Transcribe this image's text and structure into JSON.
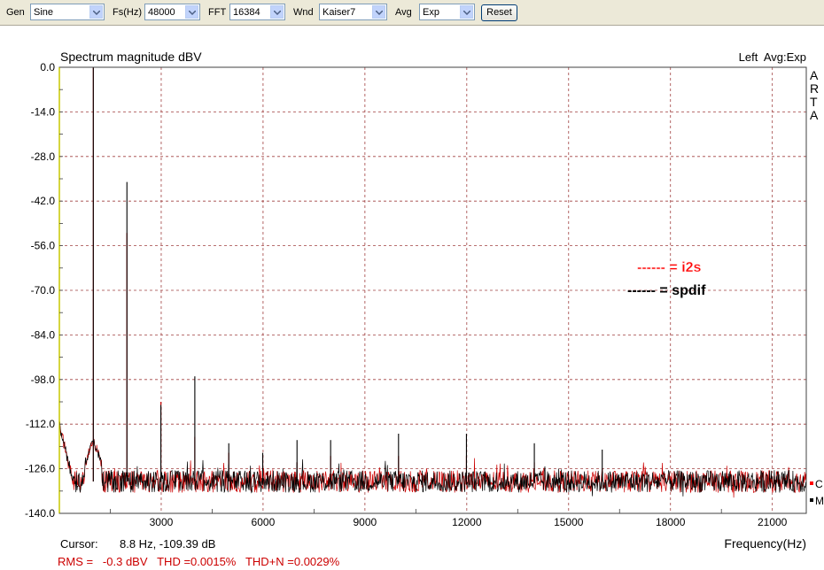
{
  "toolbar": {
    "gen_label": "Gen",
    "gen_value": "Sine",
    "fs_label": "Fs(Hz)",
    "fs_value": "48000",
    "fft_label": "FFT",
    "fft_value": "16384",
    "wnd_label": "Wnd",
    "wnd_value": "Kaiser7",
    "avg_label": "Avg",
    "avg_value": "Exp",
    "reset_label": "Reset"
  },
  "chart_data": {
    "type": "line",
    "title": "Spectrum magnitude dBV",
    "top_right_label": "Left  Avg:Exp",
    "brand_letters": [
      "A",
      "R",
      "T",
      "A"
    ],
    "xlabel": "Frequency(Hz)",
    "xlim": [
      0,
      22000
    ],
    "ylim": [
      -140,
      0
    ],
    "grid": true,
    "x_ticks": [
      3000,
      6000,
      9000,
      12000,
      15000,
      18000,
      21000
    ],
    "x_tick_labels": [
      "3000",
      "6000",
      "9000",
      "12000",
      "15000",
      "18000",
      "21000"
    ],
    "y_ticks": [
      0,
      -14,
      -28,
      -42,
      -56,
      -70,
      -84,
      -98,
      -112,
      -126,
      -140
    ],
    "y_tick_labels": [
      "0.0",
      "-14.0",
      "-28.0",
      "-42.0",
      "-56.0",
      "-70.0",
      "-84.0",
      "-98.0",
      "-112.0",
      "-126.0",
      "-140.0"
    ],
    "noise_floor_db": -130,
    "series": [
      {
        "color": "#cc0000",
        "peaks_x": [
          1000,
          1990,
          2990,
          3990,
          4990,
          5990,
          7000,
          7990,
          9990,
          11990,
          13990,
          15990
        ],
        "peaks_y": [
          0,
          -52,
          -105,
          -116,
          -121,
          -122,
          -124,
          -122,
          -122,
          -122,
          -124,
          -126
        ]
      },
      {
        "color": "#000000",
        "peaks_x": [
          1000,
          1990,
          2990,
          3990,
          4990,
          5990,
          7000,
          7990,
          9990,
          11990,
          13990,
          15990
        ],
        "peaks_y": [
          0,
          -36,
          -106,
          -97,
          -118,
          -121,
          -117,
          -117,
          -115,
          -115,
          -118,
          -120
        ]
      }
    ],
    "legend_entries": [
      {
        "text": "------ = i2s",
        "color": "#ff0000"
      },
      {
        "text": "------ = spdif",
        "color": "#000000"
      }
    ],
    "side_legend": [
      {
        "letter": "C",
        "color": "#ff0000"
      },
      {
        "letter": "M",
        "color": "#000000"
      }
    ]
  },
  "readouts": {
    "cursor_label": "Cursor:",
    "cursor_value": "8.8 Hz, -109.39 dB",
    "stats": "RMS =   -0.3 dBV   THD =0.0015%   THD+N =0.0029%"
  }
}
